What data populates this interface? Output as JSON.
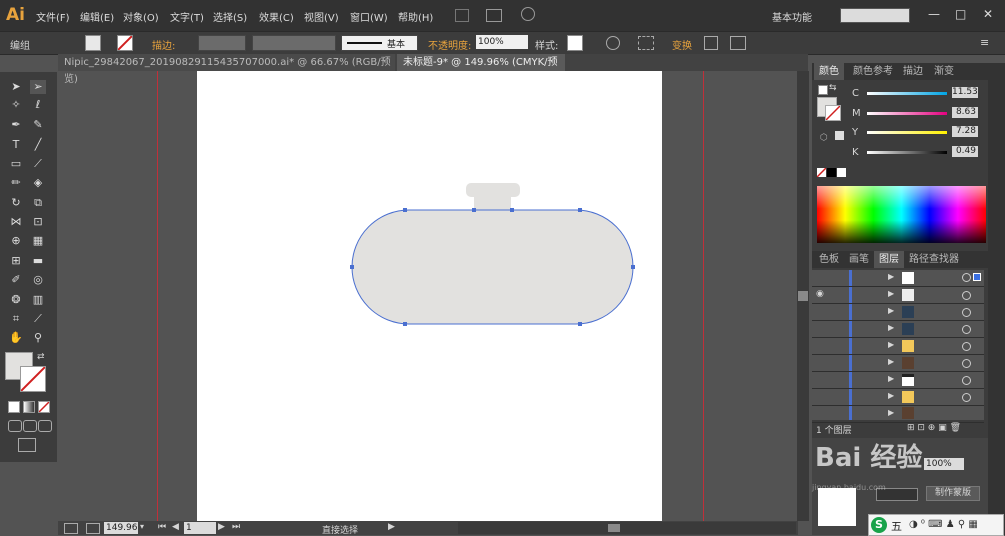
{
  "app": {
    "logo": "Ai"
  },
  "menu": [
    "文件(F)",
    "编辑(E)",
    "对象(O)",
    "文字(T)",
    "选择(S)",
    "效果(C)",
    "视图(V)",
    "窗口(W)",
    "帮助(H)"
  ],
  "workspace": "基本功能",
  "control": {
    "group_label": "编组",
    "stroke_label": "描边:",
    "stroke_style": "基本",
    "opacity_label": "不透明度:",
    "opacity_value": "100%",
    "style_label": "样式:",
    "transform_label": "变换"
  },
  "tabs": [
    {
      "label": "Nipic_29842067_20190829115435707000.ai* @ 66.67% (RGB/预览)",
      "active": false
    },
    {
      "label": "未标题-9* @ 149.96% (CMYK/预览)",
      "active": true
    }
  ],
  "status": {
    "zoom": "149.96",
    "page": "1",
    "tool": "直接选择"
  },
  "color_panel": {
    "tabs": [
      "颜色",
      "颜色参考",
      "描边",
      "渐变"
    ],
    "channels": [
      {
        "name": "C",
        "value": "11.53"
      },
      {
        "name": "M",
        "value": "8.63"
      },
      {
        "name": "Y",
        "value": "7.28"
      },
      {
        "name": "K",
        "value": "0.49"
      }
    ]
  },
  "layers_panel": {
    "tabs": [
      "色板",
      "画笔",
      "图层",
      "路径查找器"
    ],
    "footer": "1 个图层"
  },
  "bottom_panel": {
    "opacity_value": "100%",
    "make_mask": "制作蒙版"
  },
  "watermark": {
    "text": "Bai 经验",
    "sub": "jingyan.baidu.com"
  },
  "ime": {
    "label": "五"
  },
  "colors": {
    "shape_fill": "#e2e1df",
    "path_stroke": "#4a6fd0",
    "guide": "#c0303a",
    "accent": "#e8a33d"
  }
}
